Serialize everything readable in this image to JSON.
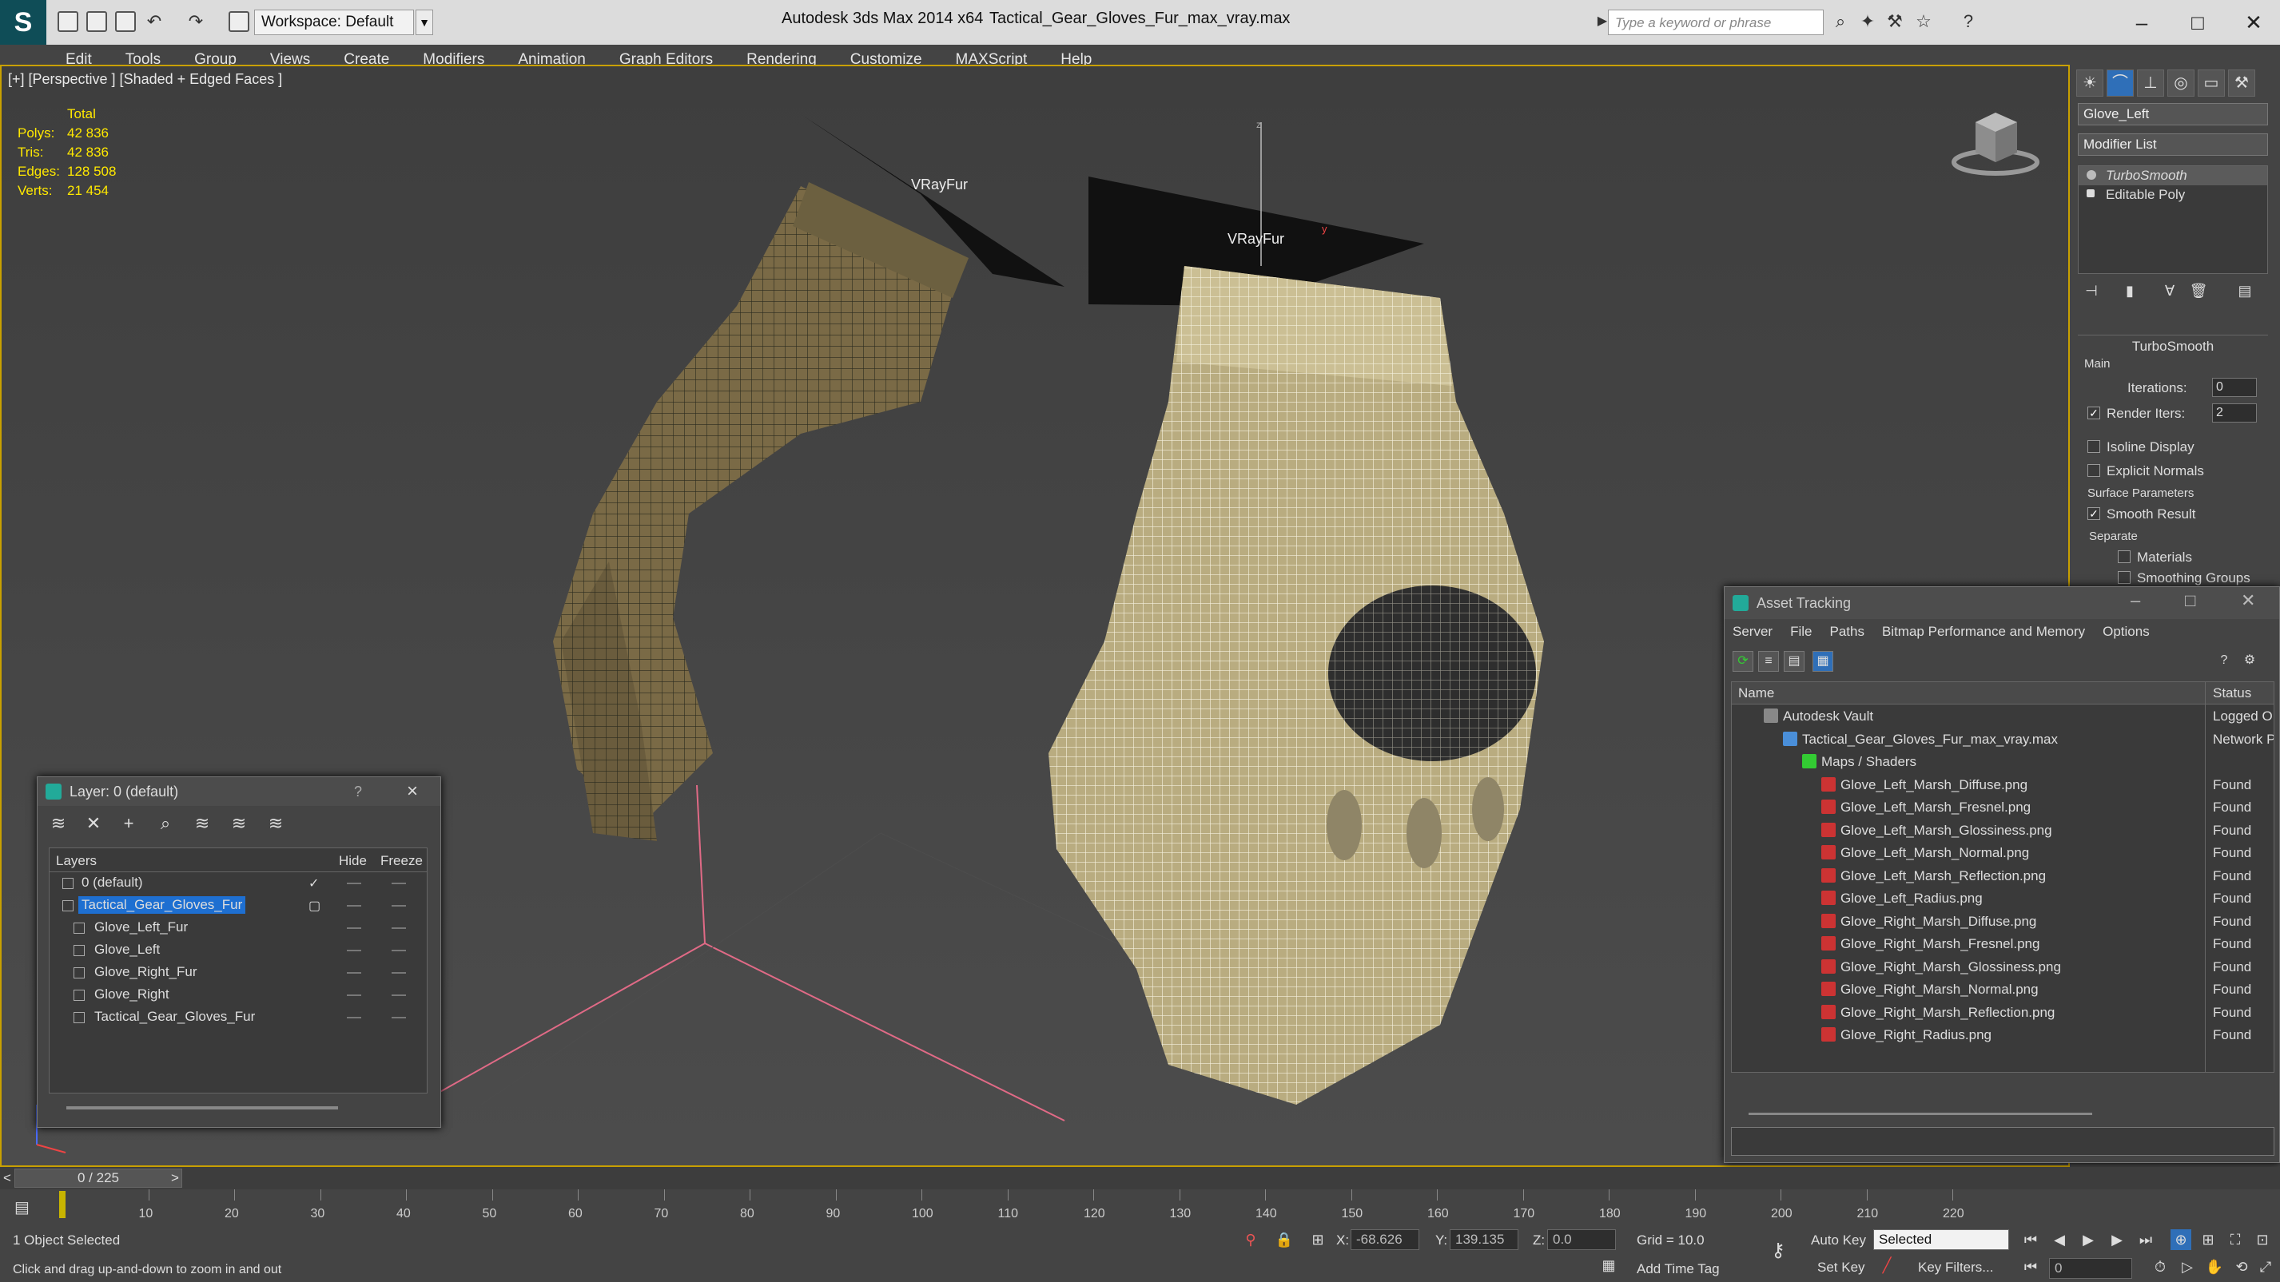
{
  "titlebar": {
    "workspace": "Workspace: Default",
    "app_title": "Autodesk 3ds Max  2014 x64",
    "file_title": "Tactical_Gear_Gloves_Fur_max_vray.max",
    "search_placeholder": "Type a keyword or phrase"
  },
  "menu": [
    "Edit",
    "Tools",
    "Group",
    "Views",
    "Create",
    "Modifiers",
    "Animation",
    "Graph Editors",
    "Rendering",
    "Customize",
    "MAXScript",
    "Help"
  ],
  "viewport": {
    "label": "[+] [Perspective ] [Shaded + Edged Faces ]",
    "stats_header": "Total",
    "stats": [
      {
        "k": "Polys:",
        "v": "42 836"
      },
      {
        "k": "Tris:",
        "v": "42 836"
      },
      {
        "k": "Edges:",
        "v": "128 508"
      },
      {
        "k": "Verts:",
        "v": "21 454"
      }
    ],
    "fur_label_1": "VRayFur",
    "fur_label_2": "VRayFur",
    "axis_label_z": "z",
    "axis_label_y": "y"
  },
  "command_panel": {
    "object_name": "Glove_Left",
    "modifier_list": "Modifier List",
    "stack": [
      "TurboSmooth",
      "Editable Poly"
    ],
    "rollout_title": "TurboSmooth",
    "main_label": "Main",
    "iterations_label": "Iterations:",
    "iterations_value": "0",
    "render_iters_label": "Render Iters:",
    "render_iters_value": "2",
    "isoline_label": "Isoline Display",
    "explicit_normals_label": "Explicit Normals",
    "surface_params_label": "Surface Parameters",
    "smooth_result_label": "Smooth Result",
    "separate_label": "Separate",
    "materials_label": "Materials",
    "smoothing_groups_label": "Smoothing Groups"
  },
  "layer_dialog": {
    "title": "Layer: 0 (default)",
    "help": "?",
    "columns": {
      "layers": "Layers",
      "hide": "Hide",
      "freeze": "Freeze"
    },
    "rows": [
      {
        "name": "0 (default)",
        "indent": 0,
        "selected": false
      },
      {
        "name": "Tactical_Gear_Gloves_Fur",
        "indent": 0,
        "selected": true
      },
      {
        "name": "Glove_Left_Fur",
        "indent": 1,
        "selected": false
      },
      {
        "name": "Glove_Left",
        "indent": 1,
        "selected": false
      },
      {
        "name": "Glove_Right_Fur",
        "indent": 1,
        "selected": false
      },
      {
        "name": "Glove_Right",
        "indent": 1,
        "selected": false
      },
      {
        "name": "Tactical_Gear_Gloves_Fur",
        "indent": 1,
        "selected": false
      }
    ]
  },
  "asset_dialog": {
    "title": "Asset Tracking",
    "menu": [
      "Server",
      "File",
      "Paths",
      "Bitmap Performance and Memory",
      "Options"
    ],
    "col_name": "Name",
    "col_status": "Status",
    "rows": [
      {
        "name": "Autodesk Vault",
        "status": "Logged O",
        "indent": 0,
        "type": "vault"
      },
      {
        "name": "Tactical_Gear_Gloves_Fur_max_vray.max",
        "status": "Network P",
        "indent": 1,
        "type": "max"
      },
      {
        "name": "Maps / Shaders",
        "status": "",
        "indent": 2,
        "type": "folder"
      },
      {
        "name": "Glove_Left_Marsh_Diffuse.png",
        "status": "Found",
        "indent": 3,
        "type": "png"
      },
      {
        "name": "Glove_Left_Marsh_Fresnel.png",
        "status": "Found",
        "indent": 3,
        "type": "png"
      },
      {
        "name": "Glove_Left_Marsh_Glossiness.png",
        "status": "Found",
        "indent": 3,
        "type": "png"
      },
      {
        "name": "Glove_Left_Marsh_Normal.png",
        "status": "Found",
        "indent": 3,
        "type": "png"
      },
      {
        "name": "Glove_Left_Marsh_Reflection.png",
        "status": "Found",
        "indent": 3,
        "type": "png"
      },
      {
        "name": "Glove_Left_Radius.png",
        "status": "Found",
        "indent": 3,
        "type": "png"
      },
      {
        "name": "Glove_Right_Marsh_Diffuse.png",
        "status": "Found",
        "indent": 3,
        "type": "png"
      },
      {
        "name": "Glove_Right_Marsh_Fresnel.png",
        "status": "Found",
        "indent": 3,
        "type": "png"
      },
      {
        "name": "Glove_Right_Marsh_Glossiness.png",
        "status": "Found",
        "indent": 3,
        "type": "png"
      },
      {
        "name": "Glove_Right_Marsh_Normal.png",
        "status": "Found",
        "indent": 3,
        "type": "png"
      },
      {
        "name": "Glove_Right_Marsh_Reflection.png",
        "status": "Found",
        "indent": 3,
        "type": "png"
      },
      {
        "name": "Glove_Right_Radius.png",
        "status": "Found",
        "indent": 3,
        "type": "png"
      }
    ]
  },
  "timeline": {
    "frame": "0 / 225",
    "ticks": [
      "10",
      "20",
      "30",
      "40",
      "50",
      "60",
      "70",
      "80",
      "90",
      "100",
      "110",
      "120",
      "130",
      "140",
      "150",
      "160",
      "170",
      "180",
      "190",
      "200",
      "210",
      "220"
    ]
  },
  "statusbar": {
    "selection": "1 Object Selected",
    "prompt": "Click and drag up-and-down to zoom in and out",
    "x_label": "X:",
    "x_value": "-68.626",
    "y_label": "Y:",
    "y_value": "139.135",
    "z_label": "Z:",
    "z_value": "0.0",
    "grid": "Grid = 10.0",
    "auto_key": "Auto Key",
    "selected_option": "Selected",
    "set_key": "Set Key",
    "key_filters": "Key Filters...",
    "add_time_tag": "Add Time Tag",
    "frame_value": "0"
  },
  "colors": {
    "accent_yellow": "#ffe800",
    "selection_blue": "#1e6fd1",
    "viewport_border": "#c8a000"
  }
}
